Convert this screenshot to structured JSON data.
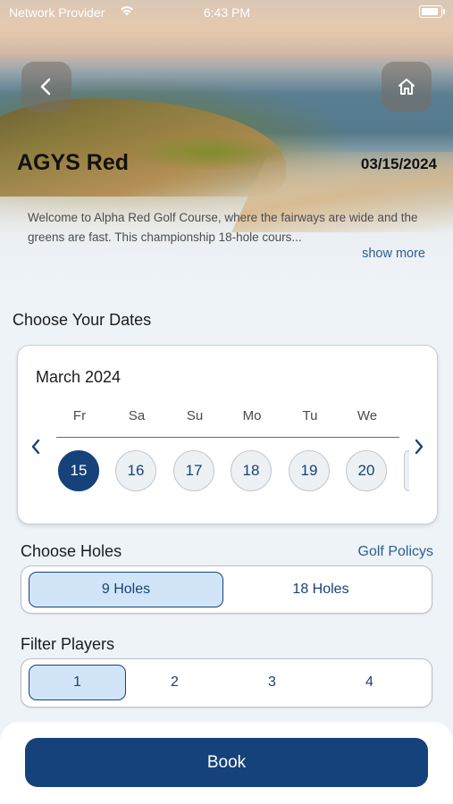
{
  "status_bar": {
    "carrier": "Network Provider",
    "time": "6:43 PM"
  },
  "header": {
    "course_name": "AGYS Red",
    "date": "03/15/2024",
    "description": "Welcome to Alpha Red Golf Course, where the fairways are wide and the greens are fast. This championship 18-hole cours...",
    "show_more": "show more"
  },
  "dates": {
    "section_title": "Choose Your Dates",
    "month": "March 2024",
    "days": [
      {
        "weekday": "Fr",
        "day": "15",
        "selected": true
      },
      {
        "weekday": "Sa",
        "day": "16",
        "selected": false
      },
      {
        "weekday": "Su",
        "day": "17",
        "selected": false
      },
      {
        "weekday": "Mo",
        "day": "18",
        "selected": false
      },
      {
        "weekday": "Tu",
        "day": "19",
        "selected": false
      },
      {
        "weekday": "We",
        "day": "20",
        "selected": false
      }
    ]
  },
  "holes": {
    "section_title": "Choose Holes",
    "policy_link": "Golf Policys",
    "options": [
      "9 Holes",
      "18 Holes"
    ],
    "selected": "9 Holes"
  },
  "players": {
    "section_title": "Filter Players",
    "options": [
      "1",
      "2",
      "3",
      "4"
    ],
    "selected": "1"
  },
  "actions": {
    "book_label": "Book"
  },
  "colors": {
    "primary": "#15427a",
    "selected_fill": "#d2e5f8",
    "link": "#2a5f8f"
  },
  "icons": {
    "back": "chevron-left-icon",
    "home": "home-icon",
    "prev": "chevron-left-icon",
    "next": "chevron-right-icon"
  }
}
